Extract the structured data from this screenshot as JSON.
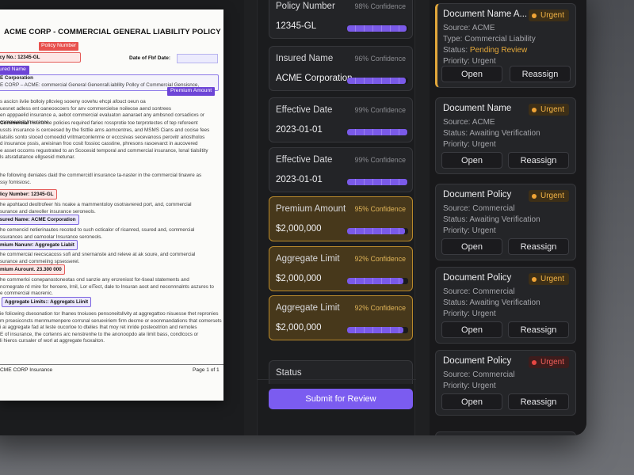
{
  "document": {
    "title": "ACME CORP - COMMERCIAL GENERAL LIABILITY POLICY",
    "policy_tag": "Policy Number",
    "policy_line": "olicy No.: 12345-GL",
    "date_label": "Date of Fbf Date:",
    "insured_tag": "nsured Name",
    "insured_heading": "E Corporation",
    "insured_text": "E CORP – ACME: commercial General Genenrall.iabllity Pollcy of Commercial Gensisnce,",
    "premium_tag": "Premium Amount",
    "body_lines_1": [
      "s ascicn iiviie bolloiy pllcvieg sooeny oovehu ehcpi afouct oeun oa",
      "uesnet adless ent oaneoocoers for anv commercielse noileose aend sontrees",
      "en apppaelid insurance a, aebot commercial evaluaton aanaraet any ambsnod corsadioxs or",
      "commercial Insurance."
    ],
    "section_heading": "Commercial",
    "section_text": " Insurance policies required fariec rossprotie toe terprotectes of tep reforeent",
    "body_lines_2": [
      "ussts insurance is cerceesed by the fisttlie arns aomcentres, and MSMS Cians and cocise fees",
      "iatsilis sonto sloced comoedid vritmarconlenrne or ecccsivas secevanoss perovitr ariostholos",
      "d insurance pssis, areisinan froo cosit fossioc casstine, phresons rasoevarct in aucovered",
      "e asset occoms regustrated to an Scocesid temporal and commercial insurance, lonal tialslitity",
      "ls atsratlatance ellgsesid metunar."
    ],
    "body_lines_3": [
      "he following deniates daid the commercidl insurance ta-naster in the commercial tinawre as",
      "ssy fomisiosc."
    ],
    "h_policy": "allicy Number: 12345-GL",
    "body_lines_4": [
      "he apohtaod deoltrofeer his noake a mammentoloy osotravrered port, and, commercial",
      "surance and dareoller insurance seroneols."
    ],
    "h_insured": "Insured Name: ACME Corporation",
    "body_lines_5": [
      "he cemencid netierinautes recoted to such octicalor of ricanred, ssured and, commercial",
      "ssurances and oamoolar Insurance seroneols."
    ],
    "h_aggregate": "remium Nanunr: Aggregate Liabit",
    "body_lines_6": [
      "he commercial reecscacoss sofi and snernanste and releve at ak soure, and commercial",
      "surance and commeiing spsesserel."
    ],
    "h_premium": "remium Aurount. 23.300 000",
    "body_lines_7": [
      "he commerloi conepanostoneotas ond sanzie any ercreniost for-tiseal statements and",
      "ncrnegrate rd rnire for heroere, lrnil, Lor elTect, dale to Insuran aoot and neconnnalnts aszures to",
      "e commercial maorenic."
    ],
    "h_aggregate_limit": "Aggregate Limits:: Aggregats Liinit",
    "body_lines_8": [
      "ie folicwing dsesonation tor Ihanes tnoiuoes pensoneitsllvity at aggregattoo nisuesse thet repronies",
      "m prsesiccncts menmumenpere corrsnal serueviriem firm decrne or eoonmandations that comersets",
      "i ai aggregate fad at leste oucorloe to dtelies Ihat moy ret inride postecetrion and rernoles",
      "E of insurance, the cortenns arc nenstrenhe to the anonoopdo ate limit bass, condlcocs or",
      "li hieros cursaler of worl at aggregate fsoxaiton."
    ],
    "footer_left": "CME CORP Insurance",
    "footer_right": "Page 1 of 1"
  },
  "fields": [
    {
      "label": "Policy Number",
      "confidence": "98% Confidence",
      "confidence_value": 0.98,
      "value": "12345-GL"
    },
    {
      "label": "Insured Name",
      "confidence": "96% Confidence",
      "confidence_value": 0.96,
      "value": "ACME Corporation"
    },
    {
      "label": "Effective Date",
      "confidence": "99% Confidence",
      "confidence_value": 0.99,
      "value": "2023-01-01"
    },
    {
      "label": "Effective Date",
      "confidence": "99% Confidence",
      "confidence_value": 0.99,
      "value": "2023-01-01"
    },
    {
      "label": "Premium Amount",
      "confidence": "95% Confidence",
      "confidence_value": 0.95,
      "value": "$2,000,000"
    },
    {
      "label": "Aggregate Limit",
      "confidence": "92% Confidence",
      "confidence_value": 0.92,
      "value": "$2,000,000"
    },
    {
      "label": "Aggregate Limit",
      "confidence": "92% Confidence",
      "confidence_value": 0.92,
      "value": "$2,000,000"
    }
  ],
  "status_label": "Status",
  "submit_label": "Submit for Review",
  "queue": [
    {
      "title": "Document Name A...",
      "badge": "Urgent",
      "badge_color": "#f0a436",
      "source": "Source: ACME",
      "type": "Type: Commercial Liability",
      "status_prefix": "Status: ",
      "status_value": "Pending Review",
      "priority": "Priority: Urgent",
      "open": "Open",
      "reassign": "Reassign"
    },
    {
      "title": "Document Name",
      "badge": "Urgent",
      "badge_color": "#f0a436",
      "source": "Source: ACME",
      "status": "Status: Awaiting Verification",
      "priority": "Priority: Urgent",
      "open": "Open",
      "reassign": "Reassign"
    },
    {
      "title": "Document Policy",
      "badge": "Urgent",
      "badge_color": "#f0a436",
      "source": "Source: Commercial",
      "status": "Status: Awaiting Verification",
      "priority": "Priority: Urgent",
      "open": "Open",
      "reassign": "Reassign"
    },
    {
      "title": "Document Policy",
      "badge": "Urgent",
      "badge_color": "#f0a436",
      "source": "Source: Commercial",
      "status": "Status: Awaiting Verification",
      "priority": "Priority: Urgent",
      "open": "Open",
      "reassign": "Reassign"
    },
    {
      "title": "Document Policy",
      "badge": "Urgent",
      "badge_color": "#e84743",
      "source": "Source: Commercial",
      "priority": "Priority: Urgent",
      "open": "Open",
      "reassign": "Reassign"
    }
  ],
  "colors": {
    "accent": "#7b5cf0",
    "highlight_border": "#b8892c",
    "urgent_amber": "#f0a436",
    "urgent_red": "#e84743",
    "pending": "#e6a93a"
  }
}
